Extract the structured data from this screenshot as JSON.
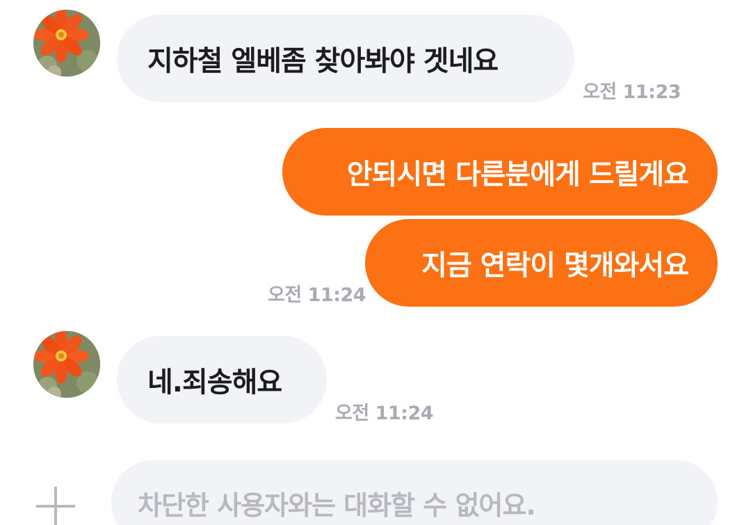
{
  "messages": [
    {
      "sender": "other",
      "text": "지하철 엘베좀  찾아봐야 겟네요",
      "time": "오전 11:23"
    },
    {
      "sender": "me",
      "text": "안되시면 다른분에게 드릴게요",
      "time": ""
    },
    {
      "sender": "me",
      "text": "지금 연락이 몇개와서요",
      "time": "오전 11:24"
    },
    {
      "sender": "other",
      "text": "네.죄송해요",
      "time": "오전 11:24"
    }
  ],
  "composer": {
    "placeholder": "차단한 사용자와는 대화할 수 없어요.",
    "plus_icon": "plus-icon"
  },
  "avatar": {
    "icon": "cactus-flower-avatar"
  },
  "colors": {
    "outgoing_bubble": "#fb7113",
    "incoming_bubble": "#f2f3f7",
    "timestamp": "#a7abb3"
  }
}
